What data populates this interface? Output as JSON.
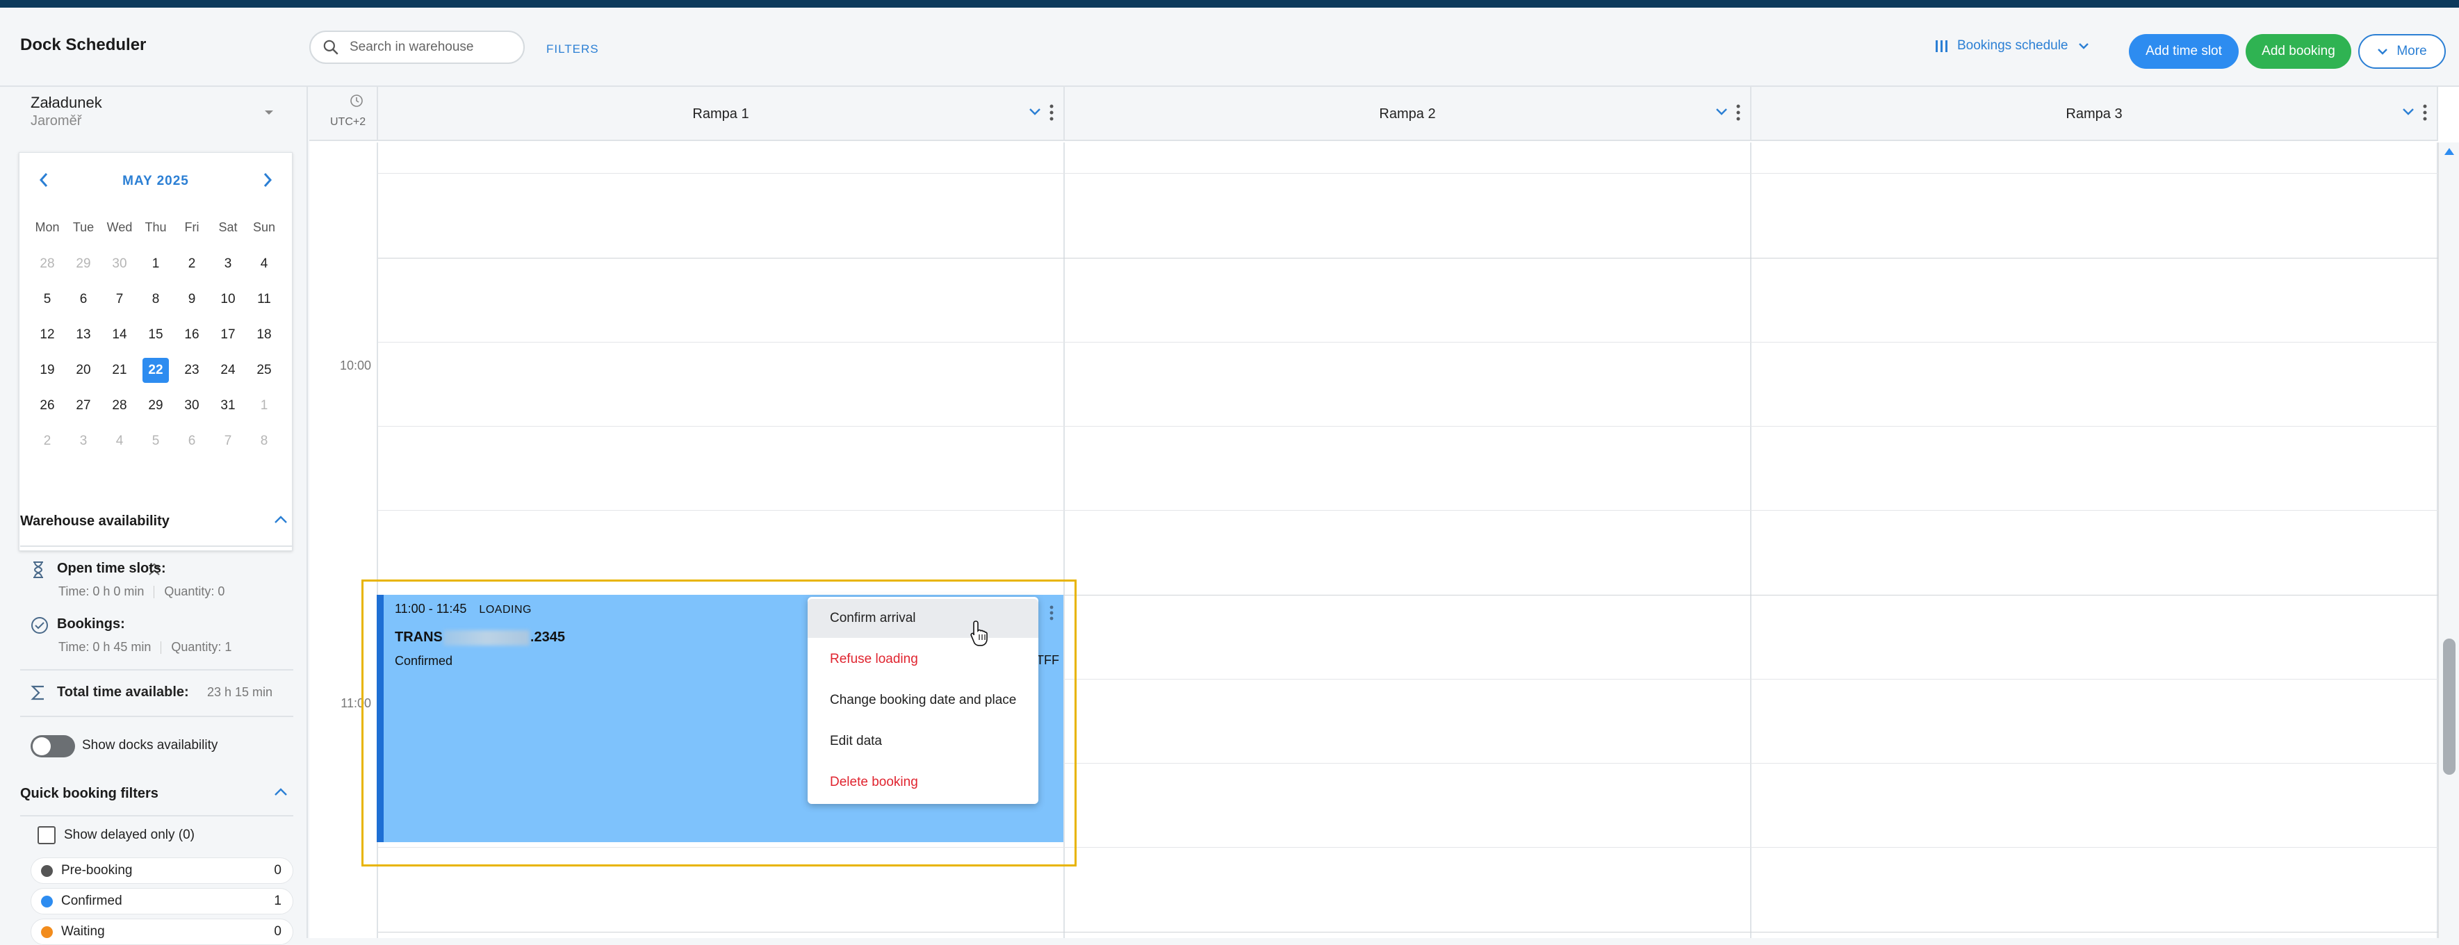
{
  "app": {
    "title": "Dock Scheduler"
  },
  "header": {
    "search_placeholder": "Search in warehouse",
    "filters_label": "FILTERS",
    "view_label": "Bookings schedule",
    "add_time_slot": "Add time slot",
    "add_booking": "Add booking",
    "more": "More"
  },
  "warehouse": {
    "name": "Załadunek",
    "city": "Jaroměř"
  },
  "calendar": {
    "month_label": "MAY 2025",
    "weekdays": [
      "Mon",
      "Tue",
      "Wed",
      "Thu",
      "Fri",
      "Sat",
      "Sun"
    ],
    "days": [
      [
        "28",
        "29",
        "30",
        "1",
        "2",
        "3",
        "4"
      ],
      [
        "5",
        "6",
        "7",
        "8",
        "9",
        "10",
        "11"
      ],
      [
        "12",
        "13",
        "14",
        "15",
        "16",
        "17",
        "18"
      ],
      [
        "19",
        "20",
        "21",
        "22",
        "23",
        "24",
        "25"
      ],
      [
        "26",
        "27",
        "28",
        "29",
        "30",
        "31",
        "1"
      ],
      [
        "2",
        "3",
        "4",
        "5",
        "6",
        "7",
        "8"
      ]
    ],
    "selected_day": "22"
  },
  "availability": {
    "title": "Warehouse availability",
    "open_slots": {
      "label": "Open time slots:",
      "time": "Time: 0 h 0 min",
      "quantity": "Quantity: 0"
    },
    "bookings": {
      "label": "Bookings:",
      "time": "Time: 0 h 45 min",
      "quantity": "Quantity: 1"
    },
    "total": {
      "label": "Total time available:",
      "value": "23 h 15 min"
    },
    "show_docks_label": "Show docks availability",
    "show_docks_on": false
  },
  "quick_filters": {
    "title": "Quick booking filters",
    "delayed_label": "Show delayed only (0)",
    "statuses": [
      {
        "name": "Pre-booking",
        "count": "0",
        "color": "#555555"
      },
      {
        "name": "Confirmed",
        "count": "1",
        "color": "#2d8cf0"
      },
      {
        "name": "Waiting",
        "count": "0",
        "color": "#f28c1c"
      }
    ]
  },
  "schedule": {
    "timezone": "UTC+2",
    "columns": [
      "Rampa 1",
      "Rampa 2",
      "Rampa 3"
    ],
    "time_labels": [
      "10:00",
      "11:00"
    ]
  },
  "booking": {
    "time": "11:00 - 11:45",
    "type": "LOADING",
    "id_prefix": "TRANS",
    "id_suffix": ".2345",
    "status": "Confirmed",
    "tail_text": "TFF"
  },
  "context_menu": {
    "items": [
      {
        "label": "Confirm arrival",
        "danger": false
      },
      {
        "label": "Refuse loading",
        "danger": true
      },
      {
        "label": "Change booking date and place",
        "danger": false
      },
      {
        "label": "Edit data",
        "danger": false
      },
      {
        "label": "Delete booking",
        "danger": true
      }
    ]
  }
}
